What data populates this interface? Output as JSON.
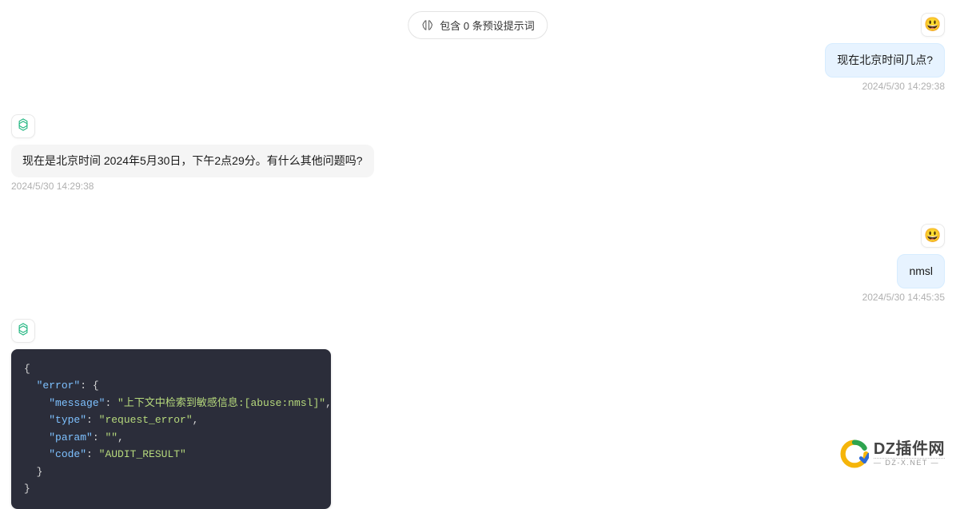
{
  "header": {
    "preset_label": "包含 0 条预设提示词"
  },
  "messages": [
    {
      "role": "user",
      "text": "现在北京时间几点?",
      "timestamp": "2024/5/30 14:29:38"
    },
    {
      "role": "assistant",
      "text": "现在是北京时间 2024年5月30日，下午2点29分。有什么其他问题吗?",
      "timestamp": "2024/5/30 14:29:38"
    },
    {
      "role": "user",
      "text": "nmsl",
      "timestamp": "2024/5/30 14:45:35"
    },
    {
      "role": "assistant",
      "is_code": true,
      "code": {
        "lines": [
          {
            "indent": 0,
            "raw": "{"
          },
          {
            "indent": 1,
            "key": "error",
            "post": ": {"
          },
          {
            "indent": 2,
            "key": "message",
            "value": "上下文中检索到敏感信息:[abuse:nmsl]",
            "comma": true
          },
          {
            "indent": 2,
            "key": "type",
            "value": "request_error",
            "comma": true
          },
          {
            "indent": 2,
            "key": "param",
            "value": "",
            "comma": true
          },
          {
            "indent": 2,
            "key": "code",
            "value": "AUDIT_RESULT"
          },
          {
            "indent": 1,
            "raw": "}"
          },
          {
            "indent": 0,
            "raw": "}"
          }
        ]
      }
    }
  ],
  "watermark": {
    "main": "DZ插件网",
    "sub": "— DZ-X.NET —"
  },
  "avatar": {
    "user_emoji": "😃"
  }
}
